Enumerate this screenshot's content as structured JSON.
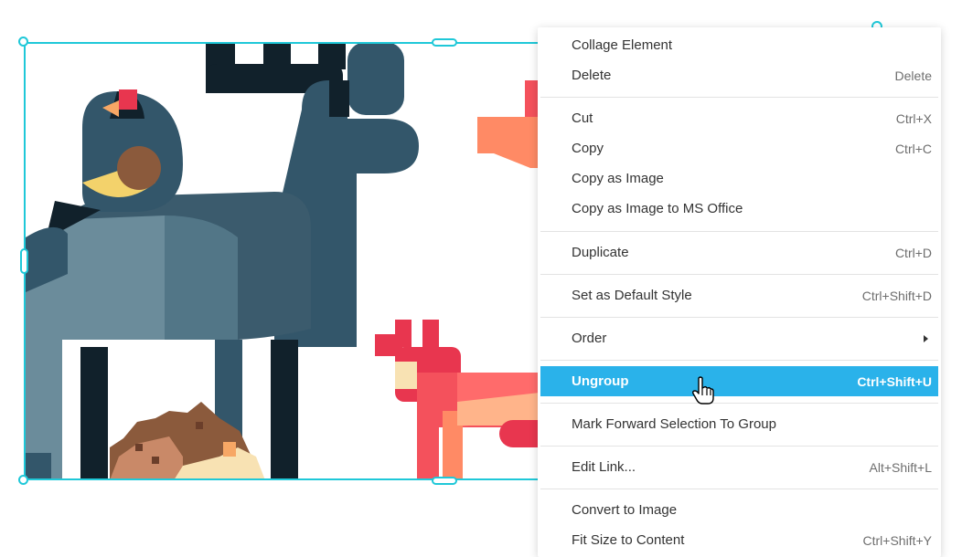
{
  "menu": {
    "items": [
      {
        "label": "Collage Element",
        "shortcut": ""
      },
      {
        "label": "Delete",
        "shortcut": "Delete"
      },
      {
        "label": "Cut",
        "shortcut": "Ctrl+X"
      },
      {
        "label": "Copy",
        "shortcut": "Ctrl+C"
      },
      {
        "label": "Copy as Image",
        "shortcut": ""
      },
      {
        "label": "Copy as Image to MS Office",
        "shortcut": ""
      },
      {
        "label": "Duplicate",
        "shortcut": "Ctrl+D"
      },
      {
        "label": "Set as Default Style",
        "shortcut": "Ctrl+Shift+D"
      },
      {
        "label": "Order",
        "shortcut": ""
      },
      {
        "label": "Ungroup",
        "shortcut": "Ctrl+Shift+U"
      },
      {
        "label": "Mark Forward Selection To Group",
        "shortcut": ""
      },
      {
        "label": "Edit Link...",
        "shortcut": "Alt+Shift+L"
      },
      {
        "label": "Convert to Image",
        "shortcut": ""
      },
      {
        "label": "Fit Size to Content",
        "shortcut": "Ctrl+Shift+Y"
      }
    ],
    "highlighted": "Ungroup",
    "submenu_item": "Order"
  },
  "colors": {
    "selection": "#1fc8d8",
    "highlight": "#2ab2ea"
  },
  "icons": {
    "cursor": "hand-pointer-icon",
    "rotate": "rotate-icon",
    "submenu": "chevron-right-icon"
  }
}
